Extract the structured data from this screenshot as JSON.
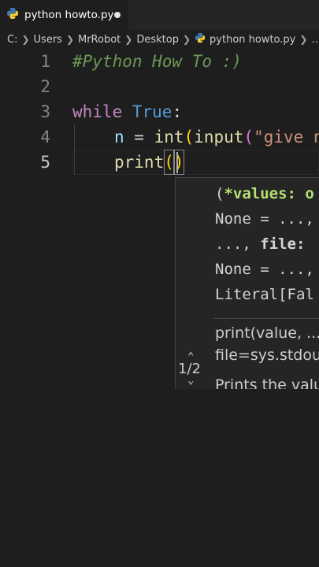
{
  "tab": {
    "filename": "python howto.py",
    "modified": true
  },
  "breadcrumb": [
    "C:",
    "Users",
    "MrRobot",
    "Desktop",
    "python howto.py",
    "..."
  ],
  "editor": {
    "line_numbers": [
      "1",
      "2",
      "3",
      "4",
      "5"
    ],
    "active_line": 5,
    "line1_comment": "#Python How To :)",
    "line3_kw": "while",
    "line3_const": "True",
    "line3_colon": ":",
    "line4_var": "n",
    "line4_eq": " = ",
    "line4_int": "int",
    "line4_p1": "(",
    "line4_input": "input",
    "line4_p2": "(",
    "line4_str": "\"give n",
    "line5_fn": "print",
    "line5_open": "(",
    "line5_close": ")"
  },
  "signature_help": {
    "counter": "1/2",
    "sig_open": "(",
    "sig_param": "*values: o",
    "sig_line2": "None = ...,",
    "sig_line3a": "..., ",
    "sig_line3b": "file:",
    "sig_line4": "None = ...,",
    "sig_line5": "Literal[Fal",
    "doc_line1": "print(value, ...",
    "doc_line2": "file=sys.stdout",
    "doc_line3": "Prints the value"
  },
  "colors": {
    "background": "#1e1e1e",
    "keyword": "#c586c0",
    "constant": "#569cd6",
    "function": "#dcdcaa",
    "string": "#ce9178",
    "comment": "#6a9955",
    "bracket": "#ffd700"
  }
}
